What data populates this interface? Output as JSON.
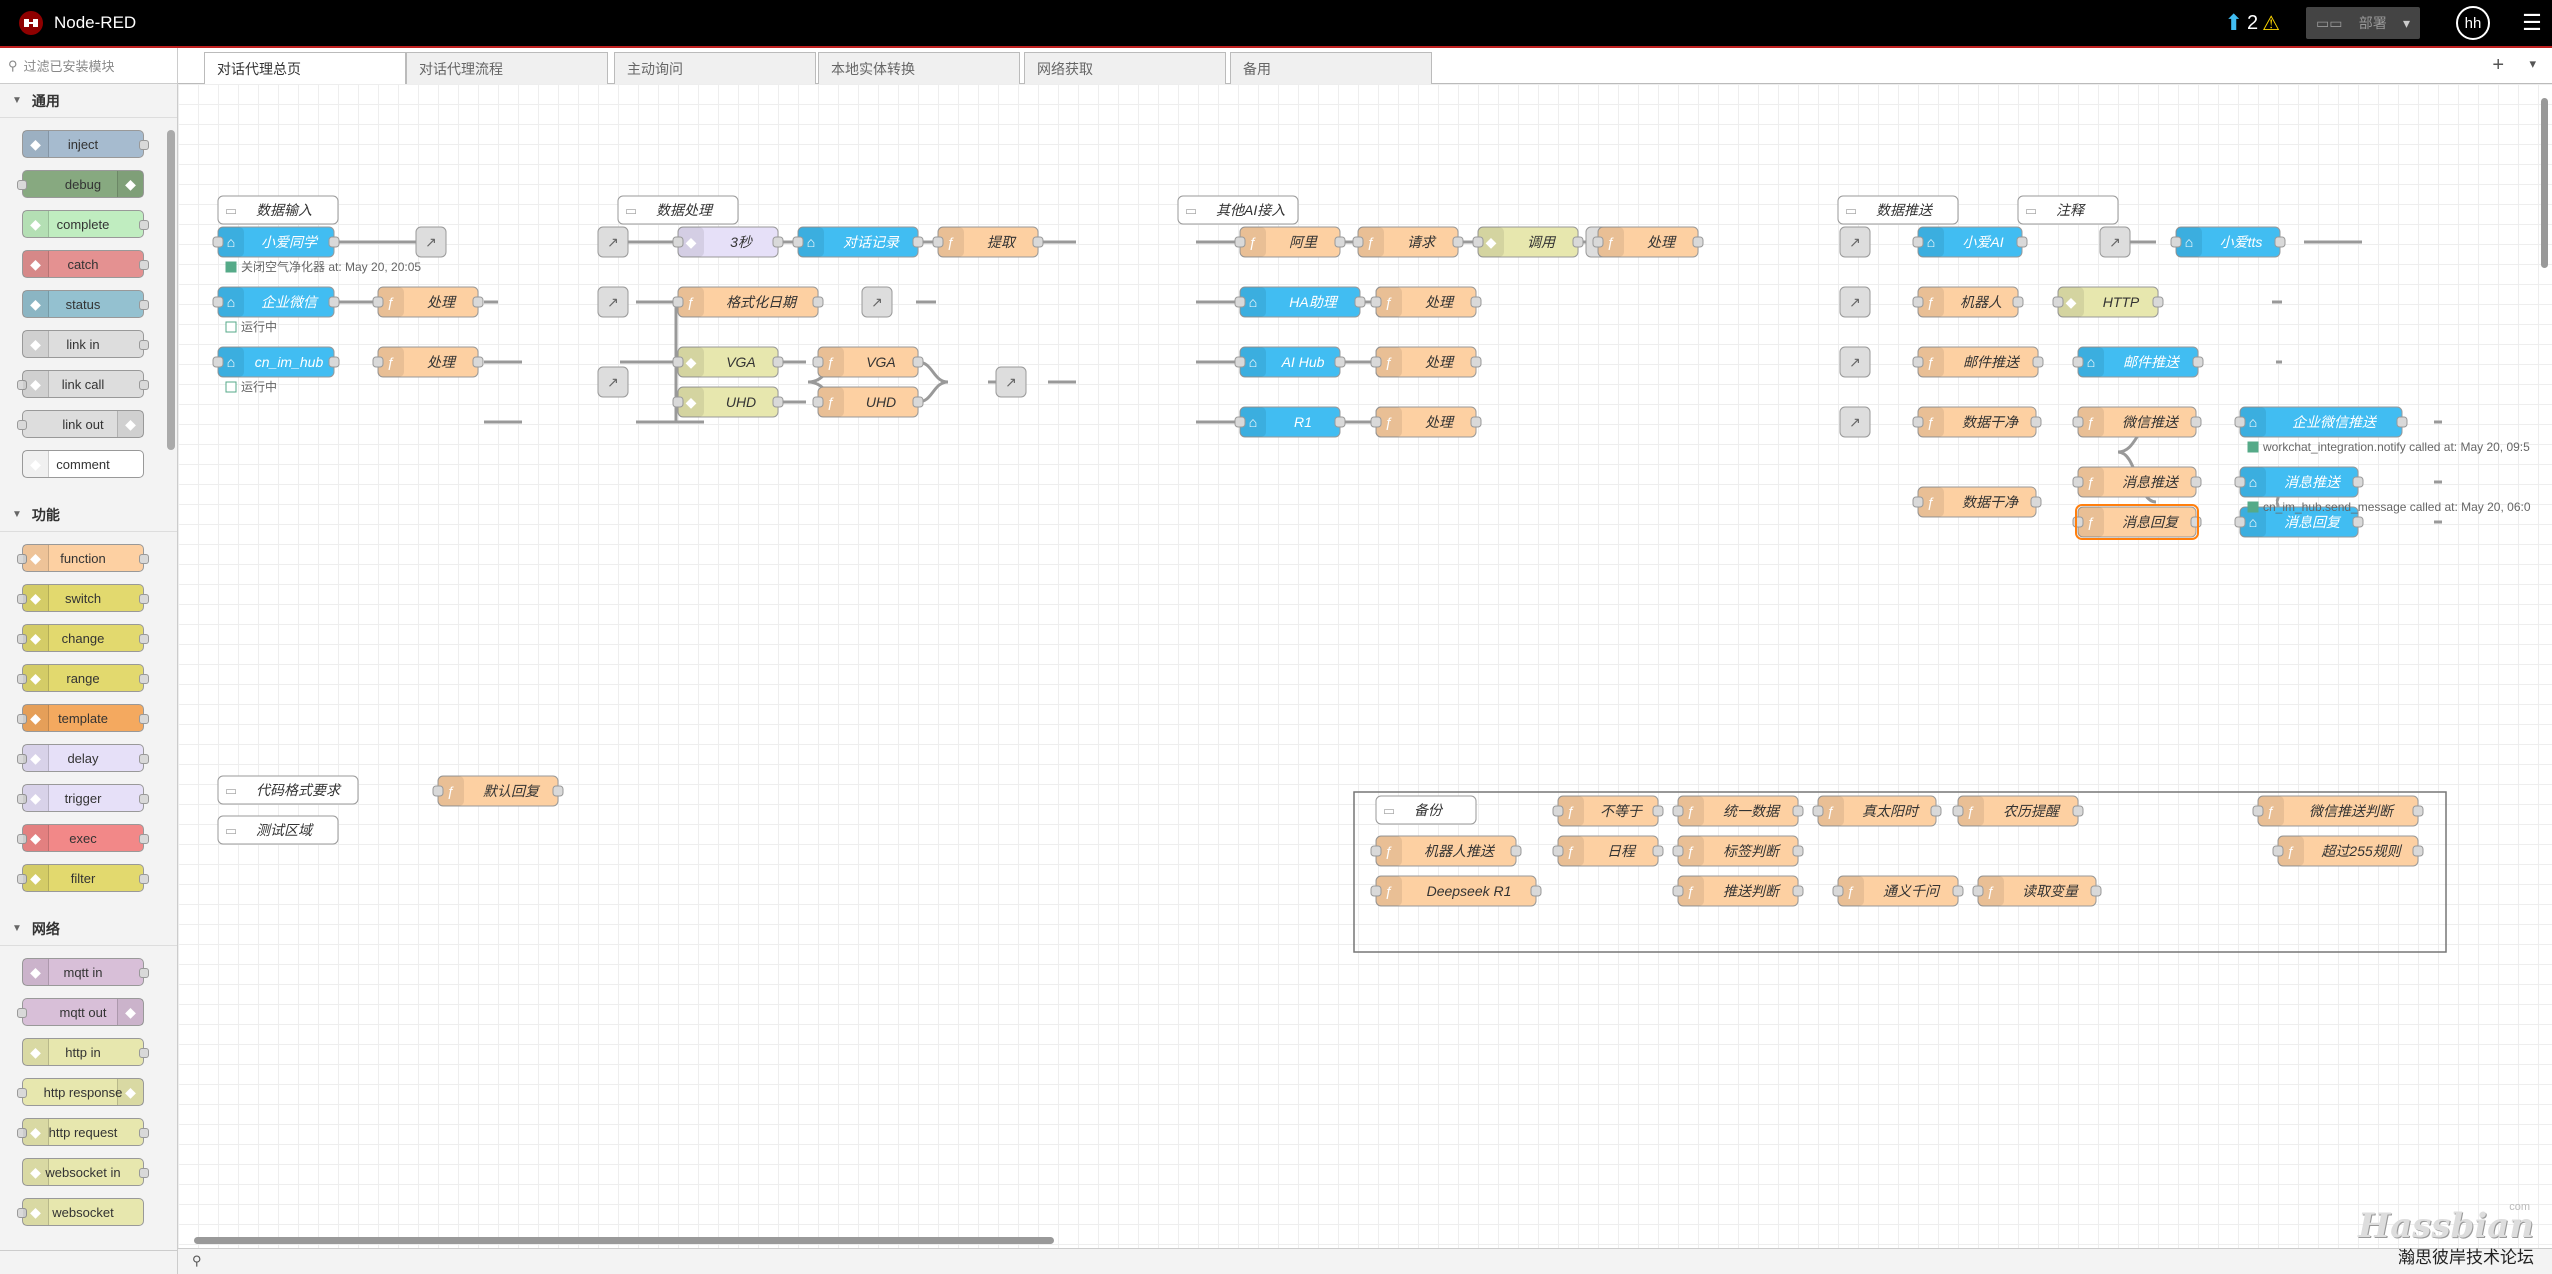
{
  "app": {
    "title": "Node-RED"
  },
  "header": {
    "notify_count": "2",
    "deploy_label": "部署",
    "user_initials": "hh"
  },
  "palette": {
    "search_placeholder": "过滤已安装模块",
    "categories": [
      {
        "name": "通用",
        "nodes": [
          {
            "label": "inject",
            "color": "#a6bbcf",
            "icon": "arrow-icon",
            "in": false,
            "out": true
          },
          {
            "label": "debug",
            "color": "#87a980",
            "icon": "list-icon",
            "in": true,
            "out": false,
            "right": true
          },
          {
            "label": "complete",
            "color": "#c0edc0",
            "icon": "exclaim-icon",
            "in": false,
            "out": true
          },
          {
            "label": "catch",
            "color": "#e49191",
            "icon": "exclaim-icon",
            "in": false,
            "out": true
          },
          {
            "label": "status",
            "color": "#94c1d0",
            "icon": "pulse-icon",
            "in": false,
            "out": true
          },
          {
            "label": "link in",
            "color": "#dddddd",
            "icon": "link-icon",
            "in": false,
            "out": true
          },
          {
            "label": "link call",
            "color": "#dddddd",
            "icon": "link-icon",
            "in": true,
            "out": true
          },
          {
            "label": "link out",
            "color": "#dddddd",
            "icon": "link-icon",
            "in": true,
            "out": false,
            "right": true
          },
          {
            "label": "comment",
            "color": "#ffffff",
            "icon": "comment-icon",
            "in": false,
            "out": false
          }
        ]
      },
      {
        "name": "功能",
        "nodes": [
          {
            "label": "function",
            "color": "#fdd0a2",
            "icon": "function-icon",
            "in": true,
            "out": true
          },
          {
            "label": "switch",
            "color": "#e2d96e",
            "icon": "switch-icon",
            "in": true,
            "out": true
          },
          {
            "label": "change",
            "color": "#e2d96e",
            "icon": "change-icon",
            "in": true,
            "out": true
          },
          {
            "label": "range",
            "color": "#e2d96e",
            "icon": "range-icon",
            "in": true,
            "out": true
          },
          {
            "label": "template",
            "color": "#f4a95f",
            "icon": "template-icon",
            "in": true,
            "out": true
          },
          {
            "label": "delay",
            "color": "#e6e0f8",
            "icon": "timer-icon",
            "in": true,
            "out": true
          },
          {
            "label": "trigger",
            "color": "#e6e0f8",
            "icon": "trigger-icon",
            "in": true,
            "out": true
          },
          {
            "label": "exec",
            "color": "#f28888",
            "icon": "gear-icon",
            "in": true,
            "out": true
          },
          {
            "label": "filter",
            "color": "#e2d96e",
            "icon": "filter-icon",
            "in": true,
            "out": true
          }
        ]
      },
      {
        "name": "网络",
        "nodes": [
          {
            "label": "mqtt in",
            "color": "#d8bfd8",
            "icon": "wave-icon",
            "in": false,
            "out": true
          },
          {
            "label": "mqtt out",
            "color": "#d8bfd8",
            "icon": "wave-icon",
            "in": true,
            "out": false,
            "right": true
          },
          {
            "label": "http in",
            "color": "#e7e7ae",
            "icon": "globe-icon",
            "in": false,
            "out": true
          },
          {
            "label": "http response",
            "color": "#e7e7ae",
            "icon": "globe-icon",
            "in": true,
            "out": false,
            "right": true
          },
          {
            "label": "http request",
            "color": "#e7e7ae",
            "icon": "globe-icon",
            "in": true,
            "out": true
          },
          {
            "label": "websocket in",
            "color": "#e7e7ae",
            "icon": "globe-icon",
            "in": false,
            "out": true
          },
          {
            "label": "websocket",
            "color": "#e7e7ae",
            "icon": "globe-icon",
            "in": true,
            "out": false
          }
        ]
      }
    ]
  },
  "tabs": [
    "对话代理总页",
    "对话代理流程",
    "主动询问",
    "本地实体转换",
    "网络获取",
    "备用"
  ],
  "active_tab": 0,
  "flow": {
    "comments": [
      {
        "id": "c1",
        "label": "数据输入"
      },
      {
        "id": "c2",
        "label": "数据处理"
      },
      {
        "id": "c3",
        "label": "其他AI接入"
      },
      {
        "id": "c4",
        "label": "数据推送"
      },
      {
        "id": "c5",
        "label": "注释"
      },
      {
        "id": "c6",
        "label": "代码格式要求"
      },
      {
        "id": "c7",
        "label": "测试区域"
      },
      {
        "id": "c8",
        "label": "备份"
      }
    ],
    "nodes": [
      {
        "id": "n1",
        "label": "小爱同学",
        "kind": "ha"
      },
      {
        "id": "n2",
        "label": "企业微信",
        "kind": "ha"
      },
      {
        "id": "n3",
        "label": "cn_im_hub",
        "kind": "ha"
      },
      {
        "id": "n4",
        "label": "处理",
        "kind": "fn"
      },
      {
        "id": "n5",
        "label": "处理",
        "kind": "fn"
      },
      {
        "id": "n6",
        "label": "3秒",
        "kind": "delay"
      },
      {
        "id": "n7",
        "label": "对话记录",
        "kind": "ha"
      },
      {
        "id": "n8",
        "label": "提取",
        "kind": "fn"
      },
      {
        "id": "n9",
        "label": "格式化日期",
        "kind": "fn"
      },
      {
        "id": "n10",
        "label": "VGA",
        "kind": "http"
      },
      {
        "id": "n11",
        "label": "UHD",
        "kind": "http"
      },
      {
        "id": "n12",
        "label": "VGA",
        "kind": "fn"
      },
      {
        "id": "n13",
        "label": "UHD",
        "kind": "fn"
      },
      {
        "id": "n14",
        "label": "阿里",
        "kind": "fn"
      },
      {
        "id": "n15",
        "label": "请求",
        "kind": "fn"
      },
      {
        "id": "n16",
        "label": "调用",
        "kind": "http"
      },
      {
        "id": "n17",
        "label": "处理",
        "kind": "fn"
      },
      {
        "id": "n18",
        "label": "HA助理",
        "kind": "ha"
      },
      {
        "id": "n19",
        "label": "处理",
        "kind": "fn"
      },
      {
        "id": "n20",
        "label": "AI Hub",
        "kind": "ha"
      },
      {
        "id": "n21",
        "label": "处理",
        "kind": "fn"
      },
      {
        "id": "n22",
        "label": "R1",
        "kind": "ha"
      },
      {
        "id": "n23",
        "label": "处理",
        "kind": "fn"
      },
      {
        "id": "n24",
        "label": "小爱AI",
        "kind": "ha"
      },
      {
        "id": "n25",
        "label": "小爱tts",
        "kind": "ha"
      },
      {
        "id": "n26",
        "label": "机器人",
        "kind": "fn"
      },
      {
        "id": "n27",
        "label": "HTTP",
        "kind": "http"
      },
      {
        "id": "n28",
        "label": "邮件推送",
        "kind": "fn"
      },
      {
        "id": "n29",
        "label": "邮件推送",
        "kind": "ha"
      },
      {
        "id": "n30",
        "label": "数据干净",
        "kind": "fn"
      },
      {
        "id": "n31",
        "label": "微信推送",
        "kind": "fn"
      },
      {
        "id": "n32",
        "label": "企业微信推送",
        "kind": "ha"
      },
      {
        "id": "n33",
        "label": "数据干净",
        "kind": "fn"
      },
      {
        "id": "n34",
        "label": "消息推送",
        "kind": "fn"
      },
      {
        "id": "n35",
        "label": "消息推送",
        "kind": "ha"
      },
      {
        "id": "n36",
        "label": "消息回复",
        "kind": "fn"
      },
      {
        "id": "n37",
        "label": "消息回复",
        "kind": "ha"
      },
      {
        "id": "n38",
        "label": "默认回复",
        "kind": "fn"
      },
      {
        "id": "n39",
        "label": "不等于",
        "kind": "fn"
      },
      {
        "id": "n40",
        "label": "统一数据",
        "kind": "fn"
      },
      {
        "id": "n41",
        "label": "真太阳时",
        "kind": "fn"
      },
      {
        "id": "n42",
        "label": "农历提醒",
        "kind": "fn"
      },
      {
        "id": "n43",
        "label": "微信推送判断",
        "kind": "fn"
      },
      {
        "id": "n44",
        "label": "机器人推送",
        "kind": "fn"
      },
      {
        "id": "n45",
        "label": "日程",
        "kind": "fn"
      },
      {
        "id": "n46",
        "label": "标签判断",
        "kind": "fn"
      },
      {
        "id": "n47",
        "label": "超过255规则",
        "kind": "fn"
      },
      {
        "id": "n48",
        "label": "Deepseek R1",
        "kind": "fn"
      },
      {
        "id": "n49",
        "label": "推送判断",
        "kind": "fn"
      },
      {
        "id": "n50",
        "label": "通义千问",
        "kind": "fn"
      },
      {
        "id": "n51",
        "label": "读取变量",
        "kind": "fn"
      }
    ],
    "statuses": [
      {
        "id": "s1",
        "text": "关闭空气净化器 at: May 20, 20:05"
      },
      {
        "id": "s2",
        "text": "运行中"
      },
      {
        "id": "s3",
        "text": "运行中"
      },
      {
        "id": "s4",
        "text": "workchat_integration.notify called at: May 20, 09:5"
      },
      {
        "id": "s5",
        "text": "cn_im_hub.send_message called at: May 20, 06:0"
      }
    ]
  },
  "colors": {
    "fn": "#fdd0a2",
    "ha": "#41bdf2",
    "http": "#e7e7ae",
    "delay": "#e6e0f8",
    "link": "#dddddd",
    "header": "#000000",
    "accent": "#c02020"
  },
  "watermark": {
    "brand": "Hassbian",
    "com": "com",
    "caption": "瀚思彼岸技术论坛"
  }
}
